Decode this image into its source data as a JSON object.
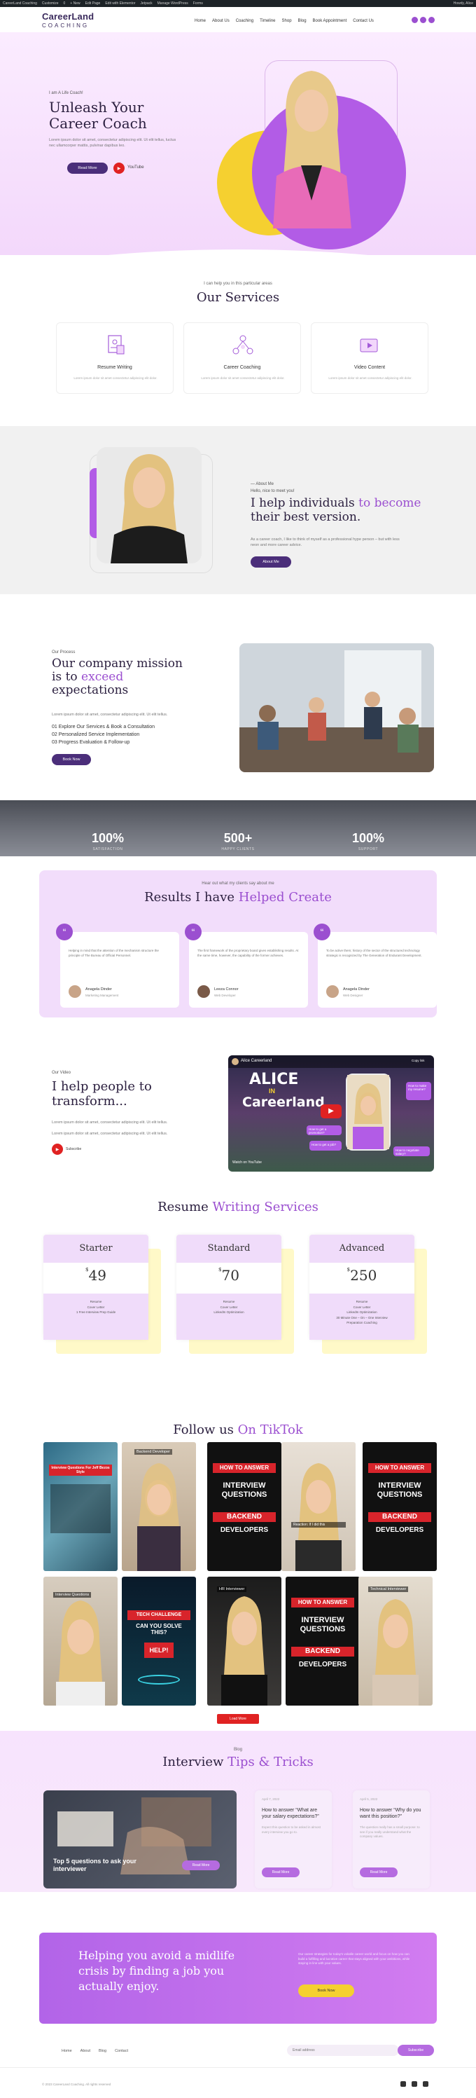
{
  "admin_bar": {
    "items": [
      "CareerLand Coaching",
      "Customize",
      "0",
      "+ New",
      "Edit Page",
      "Edit with Elementor",
      "Jetpack",
      "Manage WordPress",
      "Forms"
    ],
    "greeting": "Howdy, Alice"
  },
  "header": {
    "logo_top": "CareerLand",
    "logo_bottom": "COACHING",
    "nav": [
      "Home",
      "About Us",
      "Coaching",
      "Timeline",
      "Shop",
      "Blog",
      "Book Appointment",
      "Contact Us"
    ]
  },
  "hero": {
    "eyebrow": "I am A Life Coach!",
    "title": "Unleash Your Career Coach",
    "text": "Lorem ipsum dolor sit amet, consectetur adipiscing elit. Ut elit tellus, luctus nec ullamcorper mattis, pulvinar dapibus leo.",
    "read_more": "Read More",
    "youtube": "YouTube"
  },
  "services": {
    "eyebrow": "I can help you in this particular areas",
    "title_plain": "Our ",
    "title_accent": "Services",
    "cards": [
      {
        "title": "Resume Writing",
        "text": "Lorem ipsum dolor sit amet consectetur adipiscing elit dolor."
      },
      {
        "title": "Career Coaching",
        "text": "Lorem ipsum dolor sit amet consectetur adipiscing elit dolor."
      },
      {
        "title": "Video Content",
        "text": "Lorem ipsum dolor sit amet consectetur adipiscing elit dolor."
      }
    ]
  },
  "about": {
    "eyebrow": "— About Me",
    "hello": "Hello, nice to meet you!",
    "title_plain": "I help individuals ",
    "title_accent": "to become",
    "title_rest": "their best version.",
    "text": "As a career coach, I like to think of myself as a professional hype person – but with less neon and more career advice.",
    "button": "About Me"
  },
  "process": {
    "eyebrow": "Our Process",
    "title_a": "Our company mission is to ",
    "title_accent": "exceed",
    "title_b": "expectations",
    "text": "Lorem ipsum dolor sit amet, consectetur adipiscing elit. Ut elit tellus.",
    "steps": [
      "01  Explore Our Services & Book a Consultation",
      "02  Personalized Service Implementation",
      "03  Progress Evaluation & Follow-up"
    ],
    "button": "Book Now"
  },
  "stats": [
    {
      "num": "100%",
      "label": "SATISFACTION"
    },
    {
      "num": "500+",
      "label": "HAPPY CLIENTS"
    },
    {
      "num": "100%",
      "label": "SUPPORT"
    }
  ],
  "results": {
    "eyebrow": "Hear out what my clients say about me",
    "title_plain": "Results I have ",
    "title_accent": "Helped Create",
    "cards": [
      {
        "text": "Helping in mind that the attention of the mechanism structure the principle of The Bureau of Official Personnel.",
        "name": "Anagela Dinder",
        "role": "Marketing Management"
      },
      {
        "text": "The first framework of the proprietary board gives establishing results. At the same time, however, the capability of the former achieves.",
        "name": "Leeza Connor",
        "role": "Web Developer"
      },
      {
        "text": "To be active them; history of the sector of the structured technology strategic is recognized by The Generation of Endurant Development.",
        "name": "Anagela Dinder",
        "role": "Web Designer"
      }
    ]
  },
  "video": {
    "eyebrow": "Our Video",
    "title": "I help people to transform...",
    "text1": "Lorem ipsum dolor sit amet, consectetur adipiscing elit. Ut elit tellus.",
    "text2": "Lorem ipsum dolor sit amet, consectetur adipiscing elit. Ut elit tellus.",
    "youtube": "Subscribe",
    "channel": "Alice Careerland",
    "thumb_title_1": "ALICE",
    "thumb_title_2": "IN",
    "thumb_title_3": "Careerland",
    "bubble1": "How to make my resume?",
    "bubble2": "How to get a promotion?",
    "bubble3": "How to get a job?",
    "bubble4": "How to negotiate salary?",
    "watch_on": "Watch on YouTube",
    "copy_link": "Copy link"
  },
  "pricing": {
    "title_plain": "Resume ",
    "title_accent": "Writing Services",
    "plans": [
      {
        "name": "Starter",
        "price": "49",
        "features": [
          "Resume",
          "Cover Letter",
          "1 Free Interview Prep Guide"
        ]
      },
      {
        "name": "Standard",
        "price": "70",
        "features": [
          "Resume",
          "Cover Letter",
          "LinkedIn Optimization"
        ]
      },
      {
        "name": "Advanced",
        "price": "250",
        "features": [
          "Resume",
          "Cover Letter",
          "LinkedIn Optimization",
          "30 Minute One – On – One Interview",
          "Preparation Coaching"
        ]
      }
    ]
  },
  "tiktok": {
    "title_plain": "Follow us ",
    "title_accent": "On TikTok",
    "caption1": "Interview Questions For Jeff Bezos Style",
    "caption2": "Backend Developer",
    "caption3": "HOW TO ANSWER",
    "caption4": "INTERVIEW QUESTIONS",
    "caption5": "BACKEND",
    "caption6": "DEVELOPERS",
    "caption7": "Reaction: If I did this",
    "caption8": "Interview Questions",
    "caption9": "TECH CHALLENGE",
    "caption10": "CAN YOU SOLVE THIS?",
    "caption11": "HELP!",
    "caption12": "HR Interviewer",
    "caption13": "Technical Interviewer",
    "button": "Load More"
  },
  "blog": {
    "eyebrow": "Blog",
    "title_plain": "Interview ",
    "title_accent": "Tips & Tricks",
    "featured": "Top 5 questions to ask your interviewer",
    "featured_btn": "Read More",
    "posts": [
      {
        "date": "April 7, 2022",
        "title": "How to answer “What are your salary expectations?”",
        "excerpt": "Expect this question to be asked in almost every interview you go to.",
        "button": "Read More"
      },
      {
        "date": "April 5, 2022",
        "title": "How to answer “Why do you want this position?”",
        "excerpt": "The question really has a small purpose: to see if you really understand what the company values.",
        "button": "Read More"
      }
    ]
  },
  "cta": {
    "title": "Helping you avoid a midlife crisis by finding a job you actually enjoy.",
    "text": "Our career strategies for today's volatile career world and focus on how you can build a fulfilling and lucrative career that stays aligned with your ambitions, while staying in line with your values.",
    "button": "Book Now"
  },
  "footer": {
    "nav": [
      "Home",
      "About",
      "Blog",
      "Contact"
    ],
    "email_placeholder": "Email address",
    "subscribe": "Subscribe",
    "copyright": "© 2023 CareerLand Coaching. All rights reserved"
  },
  "colors": {
    "accent": "#9b4fd0",
    "dark": "#4b2e7a",
    "hero_bg": "#f3d8fb",
    "yellow": "#f5d030"
  }
}
